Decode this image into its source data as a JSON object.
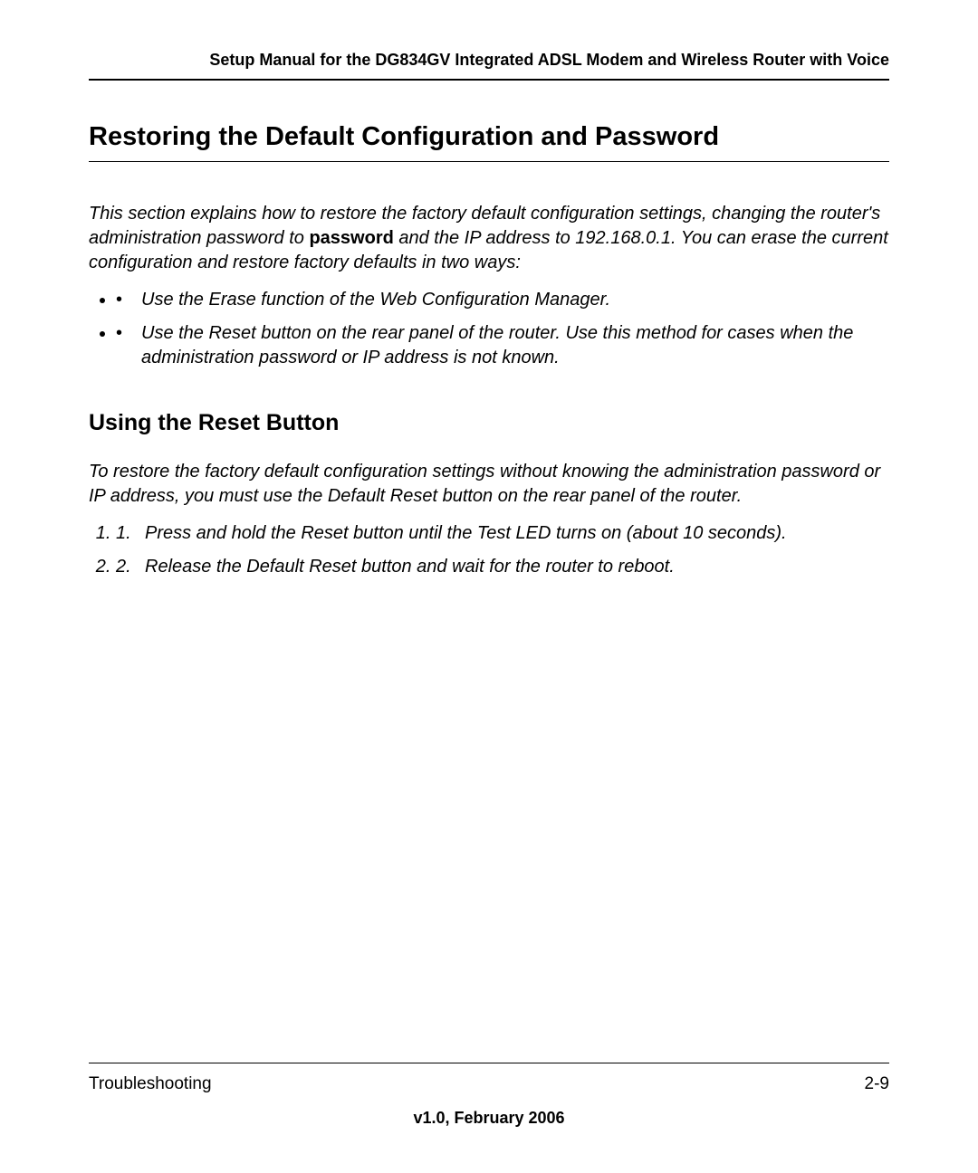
{
  "header": {
    "title": "Setup Manual for the DG834GV Integrated ADSL Modem and Wireless Router with Voice"
  },
  "h1": "Restoring the Default Configuration and Password",
  "para1_a": "This section explains how to restore the factory default configuration settings, changing the router's administration password to ",
  "para1_bold": "password",
  "para1_b": " and the IP address to 192.168.0.1. You can erase the current configuration and restore factory defaults in two ways:",
  "bullets": [
    "Use the Erase function of the Web Configuration Manager.",
    "Use the Reset button on the rear panel of the router. Use this method for cases when the administration password or IP address is not known."
  ],
  "h2": "Using the Reset Button",
  "para2": "To restore the factory default configuration settings without knowing the administration password or IP address, you must use the Default Reset button on the rear panel of the router.",
  "steps": [
    "Press and hold the Reset button until the Test LED turns on (about 10 seconds).",
    "Release the Default Reset button and wait for the router to reboot."
  ],
  "step_markers": [
    "1.",
    "2."
  ],
  "footer": {
    "section": "Troubleshooting",
    "page": "2-9",
    "version": "v1.0, February 2006"
  }
}
